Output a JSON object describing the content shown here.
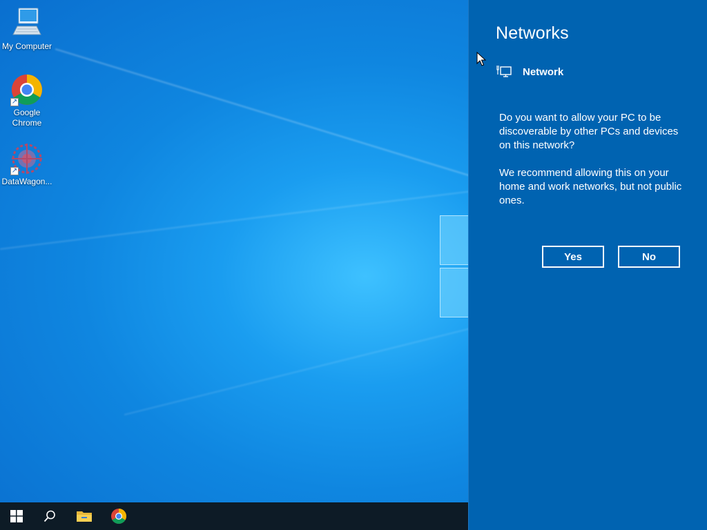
{
  "desktop": {
    "icons": [
      {
        "label": "My Computer",
        "icon": "computer-icon"
      },
      {
        "label": "Google Chrome",
        "icon": "chrome-icon",
        "shortcut": true
      },
      {
        "label": "DataWagon...",
        "icon": "datawagon-icon",
        "shortcut": true
      }
    ]
  },
  "taskbar": {
    "items": [
      {
        "name": "start",
        "icon": "windows-logo-icon"
      },
      {
        "name": "search",
        "icon": "search-icon"
      },
      {
        "name": "file-explorer",
        "icon": "folder-icon"
      },
      {
        "name": "chrome",
        "icon": "chrome-icon"
      }
    ]
  },
  "flyout": {
    "title": "Networks",
    "network_name": "Network",
    "network_icon": "ethernet-icon",
    "question": "Do you want to allow your PC to be discoverable by other PCs and devices on this network?",
    "recommendation": "We recommend allowing this on your home and work networks, but not public ones.",
    "yes_label": "Yes",
    "no_label": "No"
  },
  "colors": {
    "flyout_bg": "#0063b1",
    "taskbar_bg": "#0d1b26",
    "wallpaper": "#0f86e0"
  }
}
